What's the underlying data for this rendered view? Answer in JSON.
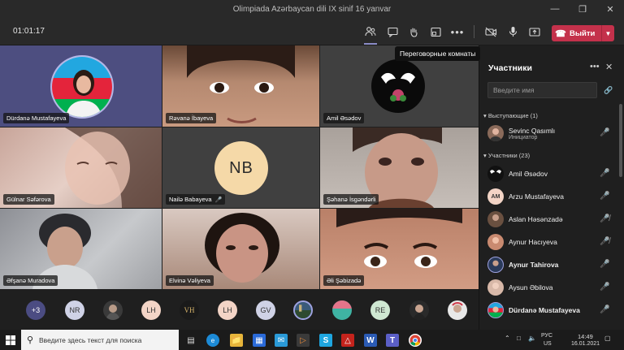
{
  "window": {
    "title": "Olimpiada Azərbaycan dili IX sinif 16 yanvar"
  },
  "toolbar": {
    "timer": "01:01:17",
    "leave_label": "Выйти",
    "tooltip": "Переговорные комнаты",
    "icons": [
      "people-icon",
      "chat-icon",
      "raise-hand-icon",
      "breakout-rooms-icon",
      "more-icon",
      "camera-off-icon",
      "mic-icon",
      "share-tray-icon",
      "phone-icon"
    ]
  },
  "grid": {
    "tiles": [
      {
        "name": "Dürdanə Mustafayeva",
        "kind": "avatar-photo"
      },
      {
        "name": "Rəvanə İbayeva",
        "kind": "video"
      },
      {
        "name": "Amil Əsədov",
        "kind": "avatar-doves"
      },
      {
        "name": "Gülnar Səfərova",
        "kind": "video"
      },
      {
        "name": "Nailə Babayeva",
        "kind": "initials",
        "initials": "NB",
        "muted": true
      },
      {
        "name": "Şəhanə İsgəndərli",
        "kind": "video"
      },
      {
        "name": "Əfşanə Muradova",
        "kind": "video"
      },
      {
        "name": "Elvinə Vəliyeva",
        "kind": "video"
      },
      {
        "name": "Əli Şəbizadə",
        "kind": "video"
      }
    ]
  },
  "strip": {
    "items": [
      "+3",
      "NR",
      "",
      "LH",
      "VH",
      "LH",
      "GV",
      "",
      "",
      "RE",
      "",
      ""
    ]
  },
  "panel": {
    "title": "Участники",
    "search_placeholder": "Введите имя",
    "presenters_header": "Выступающие (1)",
    "attendees_header": "Участники (23)",
    "presenters": [
      {
        "name": "Sevinc Qasımlı",
        "role": "Инициатор",
        "mic": "on"
      }
    ],
    "attendees": [
      {
        "name": "Amil Əsədov",
        "initials": "",
        "mic": "on",
        "bold": false
      },
      {
        "name": "Arzu Mustafayeva",
        "initials": "AM",
        "mic": "on",
        "bold": false
      },
      {
        "name": "Aslan Həsənzadə",
        "initials": "",
        "mic": "off",
        "bold": false
      },
      {
        "name": "Aynur Hacıyeva",
        "initials": "",
        "mic": "off",
        "bold": false
      },
      {
        "name": "Aynur Tahirova",
        "initials": "",
        "mic": "on",
        "bold": true
      },
      {
        "name": "Aysun Əbilova",
        "initials": "",
        "mic": "on",
        "bold": false
      },
      {
        "name": "Dürdanə Mustafayeva",
        "initials": "",
        "mic": "on",
        "bold": true
      }
    ]
  },
  "taskbar": {
    "search_placeholder": "Введите здесь текст для поиска",
    "lang": "РУС",
    "lang2": "US",
    "time": "14:49",
    "date": "16.01.2021"
  },
  "colors": {
    "accent": "#6264a7",
    "leave": "#c4314b",
    "nb_avatar": "#f5d9a8"
  }
}
